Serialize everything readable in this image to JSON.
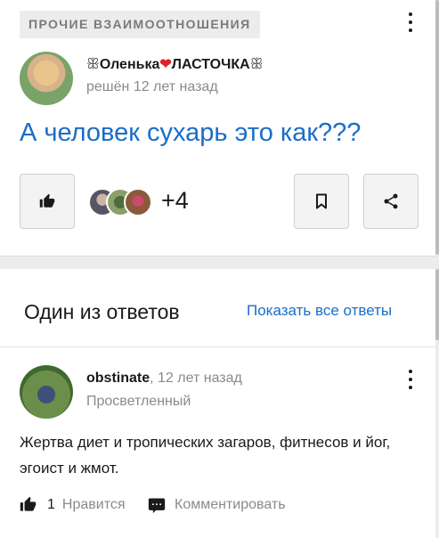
{
  "question": {
    "category": "ПРОЧИЕ ВЗАИМООТНОШЕНИЯ",
    "author": {
      "deco_left": "ꕥ",
      "name_part1": "Оленька",
      "heart": "❤",
      "name_part2": "ЛАСТОЧКА",
      "deco_right": "ꕥ"
    },
    "meta": "решён 12 лет назад",
    "title": "А человек сухарь это как???",
    "likers_more": "+4"
  },
  "answers_section": {
    "heading": "Один из ответов",
    "show_all": "Показать все ответы"
  },
  "answer": {
    "author": "obstinate",
    "time": ", 12 лет назад",
    "rank": "Просветленный",
    "text": "Жертва диет и тропических загаров, фитнесов и йог, эгоист и жмот.",
    "likes_count": "1",
    "like_label": "Нравится",
    "comment_label": "Комментировать"
  },
  "colors": {
    "link": "#1a6dc8",
    "muted": "#8a8a8a",
    "heart": "#e0202a"
  },
  "icons": [
    "kebab-menu-icon",
    "thumbs-up-icon",
    "bookmark-icon",
    "share-icon",
    "comment-icon"
  ]
}
